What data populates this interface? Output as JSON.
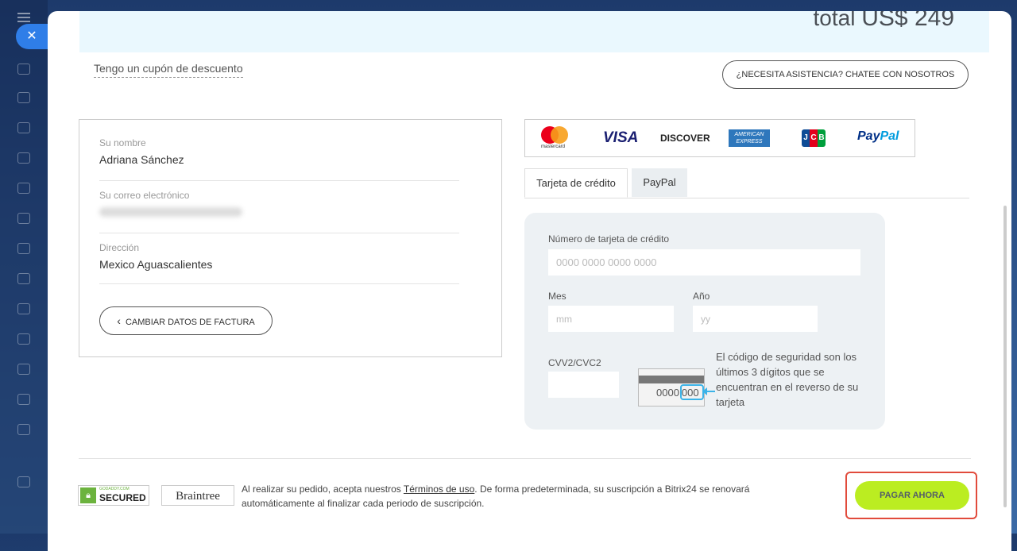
{
  "total": {
    "prefix": "total",
    "amount": "US$ 249"
  },
  "coupon_link": "Tengo un cupón de descuento",
  "chat_button": "¿NECESITA ASISTENCIA? CHATEE CON NOSOTROS",
  "billing": {
    "name_label": "Su nombre",
    "name_value": "Adriana Sánchez",
    "email_label": "Su correo electrónico",
    "address_label": "Dirección",
    "address_value": "Mexico Aguascalientes",
    "change_button": "CAMBIAR DATOS DE FACTURA"
  },
  "card_logos": {
    "mastercard": "mastercard",
    "visa": "VISA",
    "discover": "DISCOVER",
    "amex": "AMERICAN EXPRESS",
    "jcb": [
      "J",
      "C",
      "B"
    ],
    "paypal_pay": "Pay",
    "paypal_pal": "Pal"
  },
  "tabs": [
    {
      "label": "Tarjeta de crédito",
      "active": true
    },
    {
      "label": "PayPal",
      "active": false
    }
  ],
  "card_form": {
    "card_number_label": "Número de tarjeta de crédito",
    "card_number_placeholder": "0000 0000 0000 0000",
    "month_label": "Mes",
    "month_placeholder": "mm",
    "year_label": "Año",
    "year_placeholder": "yy",
    "cvv_label": "CVV2/CVC2",
    "cvv_illustration_prefix": "0000",
    "cvv_illustration_code": "000",
    "cvv_help": "El código de seguridad son los últimos 3 dígitos que se encuentran en el reverso de su tarjeta"
  },
  "footer": {
    "godaddy_small": "GODADDY.COM",
    "godaddy_big": "SECURED",
    "braintree": "Braintree",
    "terms_before": "Al realizar su pedido, acepta nuestros ",
    "terms_link": "Términos de uso",
    "terms_after": ". De forma predeterminada, su suscripción a Bitrix24 se renovará automáticamente al finalizar cada periodo de suscripción.",
    "pay_button": "PAGAR AHORA"
  },
  "colors": {
    "accent_blue": "#2f7ee8",
    "pay_green": "#bbed21",
    "highlight_red": "#e14b3c",
    "total_bg": "#eaf8fe"
  }
}
